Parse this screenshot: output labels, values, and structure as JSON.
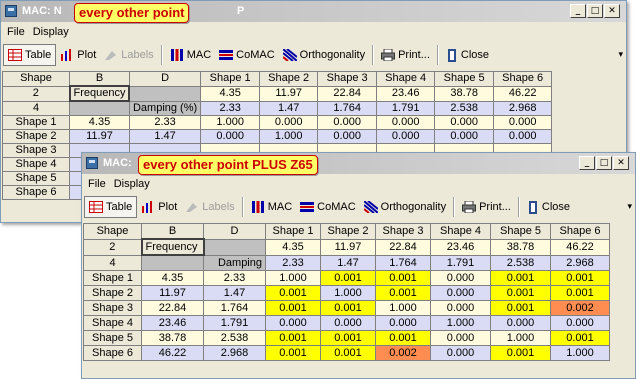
{
  "windows": [
    {
      "title": "MAC: N",
      "callout": "every other point",
      "title_tail": "P",
      "menu": [
        "File",
        "Display"
      ],
      "toolbar": {
        "table": "Table",
        "plot": "Plot",
        "labels": "Labels",
        "mac": "MAC",
        "comac": "CoMAC",
        "orthogonality": "Orthogonality",
        "print": "Print...",
        "close": "Close"
      },
      "col_widths": [
        67,
        56,
        70,
        59,
        58,
        59,
        58,
        59,
        58
      ],
      "grid": {
        "headers": [
          "Shape",
          "B",
          "D",
          "Shape 1",
          "Shape 2",
          "Shape 3",
          "Shape 4",
          "Shape 5",
          "Shape 6"
        ],
        "rows": [
          {
            "label": "2",
            "b": "Frequency",
            "d": "",
            "v": [
              "4.35",
              "11.97",
              "22.84",
              "23.46",
              "38.78",
              "46.22"
            ]
          },
          {
            "label": "4",
            "b": "",
            "d": "Damping (%)",
            "v": [
              "2.33",
              "1.47",
              "1.764",
              "1.791",
              "2.538",
              "2.968"
            ]
          },
          {
            "label": "Shape 1",
            "b": "4.35",
            "d": "2.33",
            "v": [
              "1.000",
              "0.000",
              "0.000",
              "0.000",
              "0.000",
              "0.000"
            ]
          },
          {
            "label": "Shape 2",
            "b": "11.97",
            "d": "1.47",
            "v": [
              "0.000",
              "1.000",
              "0.000",
              "0.000",
              "0.000",
              "0.000"
            ]
          },
          {
            "label": "Shape 3",
            "b": "",
            "d": "",
            "v": [
              "",
              "",
              "",
              "",
              "",
              ""
            ]
          },
          {
            "label": "Shape 4",
            "b": "",
            "d": "",
            "v": [
              "",
              "",
              "",
              "",
              "",
              ""
            ]
          },
          {
            "label": "Shape 5",
            "b": "",
            "d": "",
            "v": [
              "",
              "",
              "",
              "",
              "",
              ""
            ]
          },
          {
            "label": "Shape 6",
            "b": "",
            "d": "",
            "v": [
              "",
              "",
              "",
              "",
              "",
              ""
            ]
          }
        ]
      }
    },
    {
      "title": "MAC:",
      "callout": "every other point PLUS Z65",
      "title_tail": "",
      "menu": [
        "File",
        "Display"
      ],
      "toolbar": {
        "table": "Table",
        "plot": "Plot",
        "labels": "Labels",
        "mac": "MAC",
        "comac": "CoMAC",
        "orthogonality": "Orthogonality",
        "print": "Print...",
        "close": "Close"
      },
      "col_widths": [
        58,
        62,
        62,
        55,
        55,
        55,
        60,
        60,
        59
      ],
      "grid": {
        "headers": [
          "Shape",
          "B",
          "D",
          "Shape 1",
          "Shape 2",
          "Shape 3",
          "Shape 4",
          "Shape 5",
          "Shape 6"
        ],
        "rows": [
          {
            "label": "2",
            "b": "Frequency",
            "d": "",
            "v": [
              "4.35",
              "11.97",
              "22.84",
              "23.46",
              "38.78",
              "46.22"
            ]
          },
          {
            "label": "4",
            "b": "",
            "d": "Damping",
            "v": [
              "2.33",
              "1.47",
              "1.764",
              "1.791",
              "2.538",
              "2.968"
            ]
          },
          {
            "label": "Shape 1",
            "b": "4.35",
            "d": "2.33",
            "v": [
              "1.000",
              "0.001",
              "0.001",
              "0.000",
              "0.001",
              "0.001"
            ]
          },
          {
            "label": "Shape 2",
            "b": "11.97",
            "d": "1.47",
            "v": [
              "0.001",
              "1.000",
              "0.001",
              "0.000",
              "0.001",
              "0.001"
            ]
          },
          {
            "label": "Shape 3",
            "b": "22.84",
            "d": "1.764",
            "v": [
              "0.001",
              "0.001",
              "1.000",
              "0.000",
              "0.001",
              "0.002"
            ]
          },
          {
            "label": "Shape 4",
            "b": "23.46",
            "d": "1.791",
            "v": [
              "0.000",
              "0.000",
              "0.000",
              "1.000",
              "0.000",
              "0.000"
            ]
          },
          {
            "label": "Shape 5",
            "b": "38.78",
            "d": "2.538",
            "v": [
              "0.001",
              "0.001",
              "0.001",
              "0.000",
              "1.000",
              "0.001"
            ]
          },
          {
            "label": "Shape 6",
            "b": "46.22",
            "d": "2.968",
            "v": [
              "0.001",
              "0.001",
              "0.002",
              "0.000",
              "0.001",
              "1.000"
            ]
          }
        ]
      }
    }
  ],
  "colors": {
    "highlight_yellow": "#ffff00",
    "highlight_orange": "#ff8c50",
    "row_lavender": "#d9dcf4",
    "row_cream": "#fffbdf"
  }
}
